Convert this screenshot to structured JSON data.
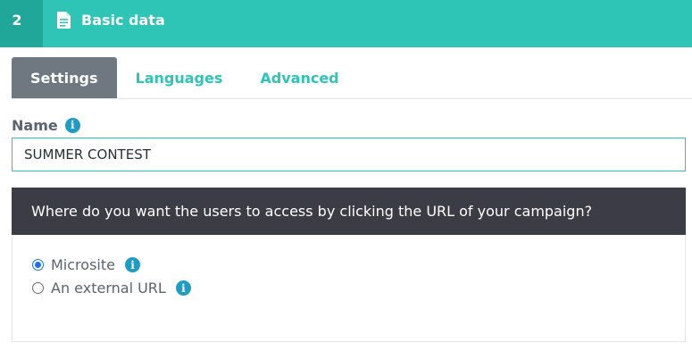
{
  "header": {
    "step_number": "2",
    "icon": "document-icon",
    "title": "Basic data",
    "colors": {
      "bar": "#2ec4b6",
      "step_bg": "#20a79a"
    }
  },
  "tabs": [
    {
      "label": "Settings",
      "active": true
    },
    {
      "label": "Languages",
      "active": false
    },
    {
      "label": "Advanced",
      "active": false
    }
  ],
  "name_field": {
    "label": "Name",
    "info_icon": "i",
    "value": "SUMMER CONTEST"
  },
  "access_panel": {
    "question": "Where do you want the users to access by clicking the URL of your campaign?",
    "options": [
      {
        "label": "Microsite",
        "selected": true,
        "info_icon": "i"
      },
      {
        "label": "An external URL",
        "selected": false,
        "info_icon": "i"
      }
    ]
  }
}
